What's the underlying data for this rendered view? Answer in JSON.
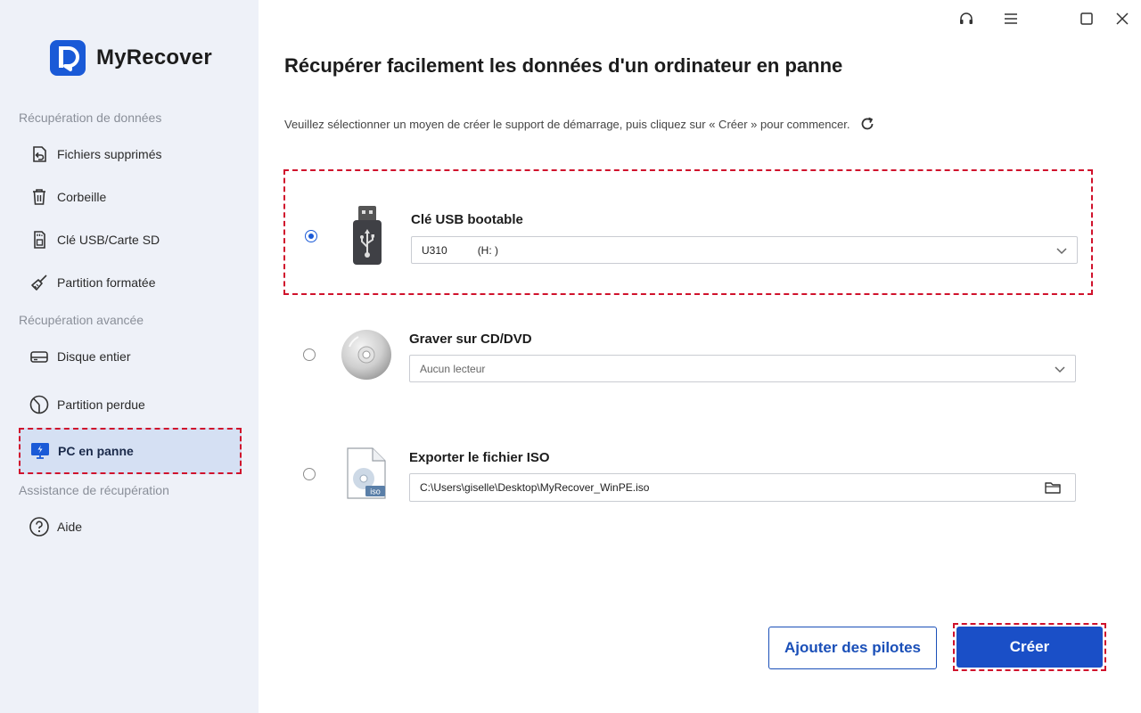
{
  "app": {
    "name": "MyRecover",
    "brand_color": "#1a5ad7",
    "highlight_color": "#d0122c"
  },
  "window_controls": {
    "support": "headset-icon",
    "menu": "hamburger-menu-icon",
    "maximize": "maximize-icon",
    "close": "close-icon"
  },
  "sidebar": {
    "sections": [
      {
        "label": "Récupération de données",
        "items": [
          {
            "label": "Fichiers supprimés",
            "icon": "undo-file-icon"
          },
          {
            "label": "Corbeille",
            "icon": "trash-icon"
          },
          {
            "label": "Clé USB/Carte SD",
            "icon": "sd-card-icon"
          },
          {
            "label": "Partition formatée",
            "icon": "broom-icon"
          }
        ]
      },
      {
        "label": "Récupération avancée",
        "items": [
          {
            "label": "Disque entier",
            "icon": "hard-disk-icon"
          },
          {
            "label": "Partition perdue",
            "icon": "pie-partition-icon"
          },
          {
            "label": "PC en panne",
            "icon": "crashed-pc-icon",
            "active": true
          }
        ]
      },
      {
        "label": "Assistance de récupération",
        "items": [
          {
            "label": "Aide",
            "icon": "help-icon"
          }
        ]
      }
    ]
  },
  "main": {
    "title": "Récupérer facilement les données d'un ordinateur en panne",
    "subtitle": "Veuillez sélectionner un moyen de créer le support de démarrage, puis cliquez sur « Créer » pour commencer.",
    "options": [
      {
        "label": "Clé USB bootable",
        "selected": true,
        "device_name": "U310",
        "device_letter": "(H: )",
        "icon": "usb-drive-icon"
      },
      {
        "label": "Graver sur CD/DVD",
        "selected": false,
        "value": "Aucun lecteur",
        "icon": "cd-dvd-icon"
      },
      {
        "label": "Exporter le fichier ISO",
        "selected": false,
        "value": "C:\\Users\\giselle\\Desktop\\MyRecover_WinPE.iso",
        "icon": "iso-file-icon",
        "icon_badge": "iso"
      }
    ],
    "buttons": {
      "drivers": "Ajouter des pilotes",
      "create": "Créer"
    }
  }
}
